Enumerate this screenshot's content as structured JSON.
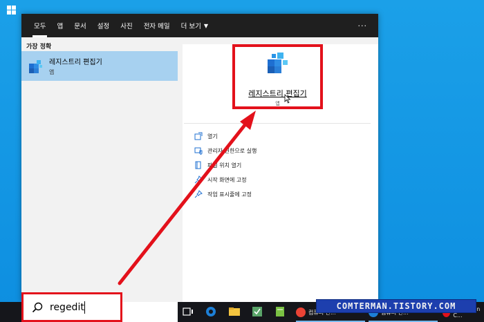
{
  "tabs": [
    {
      "label": "모두"
    },
    {
      "label": "앱"
    },
    {
      "label": "문서"
    },
    {
      "label": "설정"
    },
    {
      "label": "사진"
    },
    {
      "label": "전자 메일"
    },
    {
      "label": "더 보기"
    }
  ],
  "more_dots": "···",
  "best_match": {
    "section_label": "가장 정확",
    "title": "레지스트리 편집기",
    "subtitle": "앱"
  },
  "detail": {
    "title": "레지스트리 편집기",
    "subtitle": "앱",
    "actions": [
      {
        "label": "열기",
        "icon": "open-icon"
      },
      {
        "label": "관리자 권한으로 실행",
        "icon": "shield-icon"
      },
      {
        "label": "파일 위치 열기",
        "icon": "file-location-icon"
      },
      {
        "label": "시작 화면에 고정",
        "icon": "pin-icon"
      },
      {
        "label": "작업 표시줄에 고정",
        "icon": "pin-icon"
      }
    ]
  },
  "search": {
    "value": "regedit",
    "icon": "search-icon"
  },
  "taskbar": {
    "apps": [
      {
        "label": "컴퓨터 관..."
      },
      {
        "label": "컴퓨터 관..."
      },
      {
        "label": "OnScreen C..."
      }
    ]
  },
  "watermark": "COMTERMAN.TISTORY.COM",
  "colors": {
    "desktop": "#1ba0e8",
    "tabbar": "#1f1f1f",
    "selected_result": "#a7d1f0",
    "annotation_red": "#e3111b",
    "taskbar": "#15161b"
  }
}
